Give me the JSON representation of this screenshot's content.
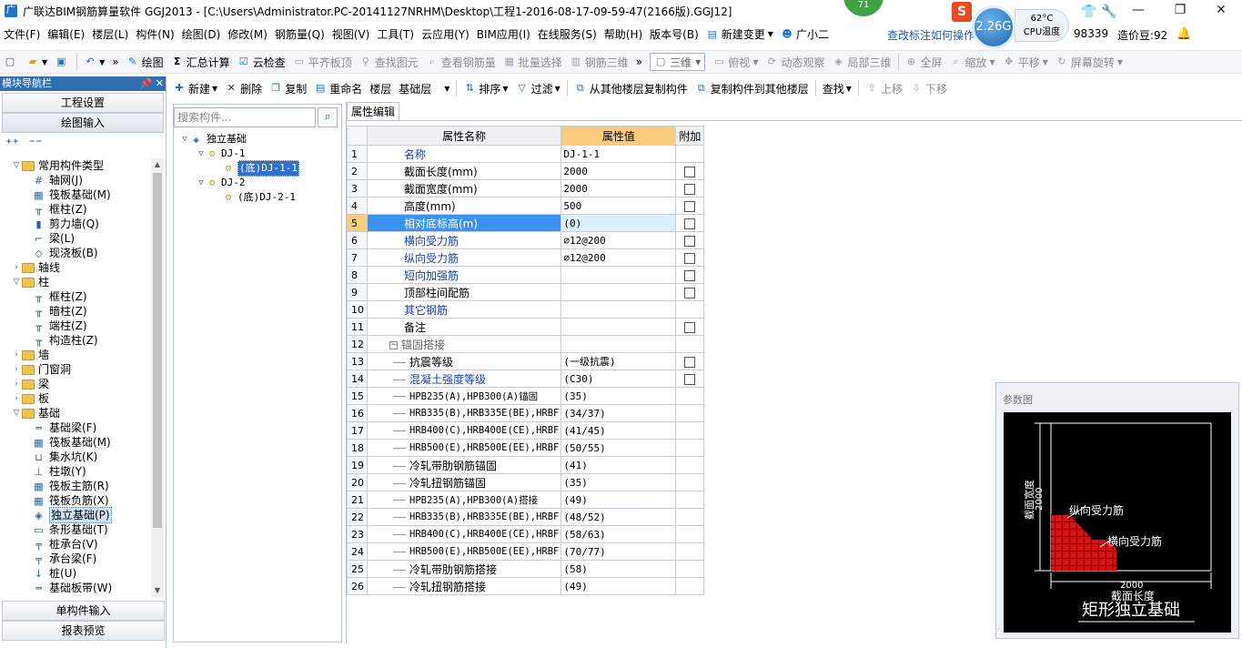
{
  "window": {
    "title": "广联达BIM钢筋算量软件 GGJ2013 - [C:\\Users\\Administrator.PC-20141127NRHM\\Desktop\\工程1-2016-08-17-09-59-47(2166版).GGJ12]",
    "app_icon": "广",
    "badge": "71",
    "speed": "2.26G",
    "cpu_temp": "62°C",
    "cpu_label": "CPU温度",
    "minimize": "—",
    "restore": "❐",
    "close": "✕"
  },
  "menu": {
    "items": [
      "文件(F)",
      "编辑(E)",
      "楼层(L)",
      "构件(N)",
      "绘图(D)",
      "修改(M)",
      "钢筋量(Q)",
      "视图(V)",
      "工具(T)",
      "云应用(Y)",
      "BIM应用(I)",
      "在线服务(S)",
      "帮助(H)",
      "版本号(B)"
    ],
    "new_change": "新建变更",
    "xiaoer": "广小二",
    "link": "查改标注如何操作",
    "account": "98339",
    "price_bean": "造价豆:92"
  },
  "toolbar": {
    "items": [
      "绘图",
      "汇总计算",
      "云检查",
      "平齐板顶",
      "查找图元",
      "查看钢筋量",
      "批量选择",
      "钢筋三维"
    ],
    "view_mode": "三维",
    "items2": [
      "俯视",
      "动态观察",
      "局部三维",
      "全屏",
      "缩放",
      "平移",
      "屏幕旋转"
    ]
  },
  "nav": {
    "header": "模块导航栏",
    "project_settings": "工程设置",
    "drawing_input": "绘图输入",
    "single_input": "单构件输入",
    "report_preview": "报表预览",
    "tree": [
      {
        "level": 0,
        "type": "folder",
        "exp": "▽",
        "label": "常用构件类型"
      },
      {
        "level": 1,
        "type": "item",
        "icon": "#",
        "label": "轴网(J)"
      },
      {
        "level": 1,
        "type": "item",
        "icon": "▦",
        "label": "筏板基础(M)"
      },
      {
        "level": 1,
        "type": "item",
        "icon": "╥",
        "label": "框柱(Z)"
      },
      {
        "level": 1,
        "type": "item",
        "icon": "▮",
        "label": "剪力墙(Q)"
      },
      {
        "level": 1,
        "type": "item",
        "icon": "⌐",
        "label": "梁(L)"
      },
      {
        "level": 1,
        "type": "item",
        "icon": "◇",
        "label": "现浇板(B)"
      },
      {
        "level": 0,
        "type": "folder",
        "exp": "›",
        "label": "轴线"
      },
      {
        "level": 0,
        "type": "folder",
        "exp": "▽",
        "label": "柱"
      },
      {
        "level": 1,
        "type": "item",
        "icon": "╥",
        "label": "框柱(Z)"
      },
      {
        "level": 1,
        "type": "item",
        "icon": "╥",
        "label": "暗柱(Z)"
      },
      {
        "level": 1,
        "type": "item",
        "icon": "╥",
        "label": "端柱(Z)"
      },
      {
        "level": 1,
        "type": "item",
        "icon": "╥",
        "label": "构造柱(Z)"
      },
      {
        "level": 0,
        "type": "folder",
        "exp": "›",
        "label": "墙"
      },
      {
        "level": 0,
        "type": "folder",
        "exp": "›",
        "label": "门窗洞"
      },
      {
        "level": 0,
        "type": "folder",
        "exp": "›",
        "label": "梁"
      },
      {
        "level": 0,
        "type": "folder",
        "exp": "›",
        "label": "板"
      },
      {
        "level": 0,
        "type": "folder",
        "exp": "▽",
        "label": "基础"
      },
      {
        "level": 1,
        "type": "item",
        "icon": "═",
        "label": "基础梁(F)"
      },
      {
        "level": 1,
        "type": "item",
        "icon": "▦",
        "label": "筏板基础(M)"
      },
      {
        "level": 1,
        "type": "item",
        "icon": "⊔",
        "label": "集水坑(K)"
      },
      {
        "level": 1,
        "type": "item",
        "icon": "⊥",
        "label": "柱墩(Y)"
      },
      {
        "level": 1,
        "type": "item",
        "icon": "▦",
        "label": "筏板主筋(R)"
      },
      {
        "level": 1,
        "type": "item",
        "icon": "▦",
        "label": "筏板负筋(X)"
      },
      {
        "level": 1,
        "type": "item",
        "icon": "◈",
        "label": "独立基础(P)",
        "selected": true
      },
      {
        "level": 1,
        "type": "item",
        "icon": "▭",
        "label": "条形基础(T)"
      },
      {
        "level": 1,
        "type": "item",
        "icon": "╤",
        "label": "桩承台(V)"
      },
      {
        "level": 1,
        "type": "item",
        "icon": "╤",
        "label": "承台梁(F)"
      },
      {
        "level": 1,
        "type": "item",
        "icon": "↓",
        "label": "桩(U)"
      },
      {
        "level": 1,
        "type": "item",
        "icon": "═",
        "label": "基础板带(W)"
      }
    ]
  },
  "comp_toolbar": [
    "新建",
    "删除",
    "复制",
    "重命名",
    "楼层",
    "基础层",
    "排序",
    "过滤",
    "从其他楼层复制构件",
    "复制构件到其他楼层",
    "查找",
    "上移",
    "下移"
  ],
  "comp_tree": {
    "search_placeholder": "搜索构件...",
    "nodes": [
      {
        "level": 0,
        "exp": "▽",
        "label": "独立基础",
        "kind": "root"
      },
      {
        "level": 1,
        "exp": "▽",
        "label": "DJ-1",
        "kind": "gear"
      },
      {
        "level": 2,
        "exp": "",
        "label": "(底)DJ-1-1",
        "kind": "gear",
        "selected": true
      },
      {
        "level": 1,
        "exp": "▽",
        "label": "DJ-2",
        "kind": "gear"
      },
      {
        "level": 2,
        "exp": "",
        "label": "(底)DJ-2-1",
        "kind": "gear"
      }
    ]
  },
  "props": {
    "tab": "属性编辑",
    "col_name": "属性名称",
    "col_value": "属性值",
    "col_add": "附加",
    "rows": [
      {
        "n": "1",
        "name": "名称",
        "value": "DJ-1-1",
        "cb": false,
        "style": "blue"
      },
      {
        "n": "2",
        "name": "截面长度(mm)",
        "value": "2000",
        "cb": true,
        "style": ""
      },
      {
        "n": "3",
        "name": "截面宽度(mm)",
        "value": "2000",
        "cb": true,
        "style": ""
      },
      {
        "n": "4",
        "name": "高度(mm)",
        "value": "500",
        "cb": true,
        "style": ""
      },
      {
        "n": "5",
        "name": "相对底标高(m)",
        "value": "(0)",
        "cb": true,
        "style": "sel"
      },
      {
        "n": "6",
        "name": "横向受力筋",
        "value": "⌀12@200",
        "cb": true,
        "style": "blue"
      },
      {
        "n": "7",
        "name": "纵向受力筋",
        "value": "⌀12@200",
        "cb": true,
        "style": "blue"
      },
      {
        "n": "8",
        "name": "短向加强筋",
        "value": "",
        "cb": true,
        "style": "blue"
      },
      {
        "n": "9",
        "name": "顶部柱间配筋",
        "value": "",
        "cb": true,
        "style": ""
      },
      {
        "n": "10",
        "name": "其它钢筋",
        "value": "",
        "cb": false,
        "style": "blue"
      },
      {
        "n": "11",
        "name": "备注",
        "value": "",
        "cb": true,
        "style": ""
      },
      {
        "n": "12",
        "name": "锚固搭接",
        "value": "",
        "cb": false,
        "style": "group"
      },
      {
        "n": "13",
        "name": "抗震等级",
        "value": "(一级抗震)",
        "cb": true,
        "style": "child"
      },
      {
        "n": "14",
        "name": "混凝土强度等级",
        "value": "(C30)",
        "cb": true,
        "style": "child blue"
      },
      {
        "n": "15",
        "name": "HPB235(A),HPB300(A)锚固",
        "value": "(35)",
        "cb": false,
        "style": "child mono"
      },
      {
        "n": "16",
        "name": "HRB335(B),HRB335E(BE),HRBF",
        "value": "(34/37)",
        "cb": false,
        "style": "child mono"
      },
      {
        "n": "17",
        "name": "HRB400(C),HRB400E(CE),HRBF",
        "value": "(41/45)",
        "cb": false,
        "style": "child mono"
      },
      {
        "n": "18",
        "name": "HRB500(E),HRB500E(EE),HRBF",
        "value": "(50/55)",
        "cb": false,
        "style": "child mono"
      },
      {
        "n": "19",
        "name": "冷轧带肋钢筋锚固",
        "value": "(41)",
        "cb": false,
        "style": "child"
      },
      {
        "n": "20",
        "name": "冷轧扭钢筋锚固",
        "value": "(35)",
        "cb": false,
        "style": "child"
      },
      {
        "n": "21",
        "name": "HPB235(A),HPB300(A)搭接",
        "value": "(49)",
        "cb": false,
        "style": "child mono"
      },
      {
        "n": "22",
        "name": "HRB335(B),HRB335E(BE),HRBF",
        "value": "(48/52)",
        "cb": false,
        "style": "child mono"
      },
      {
        "n": "23",
        "name": "HRB400(C),HRB400E(CE),HRBF",
        "value": "(58/63)",
        "cb": false,
        "style": "child mono"
      },
      {
        "n": "24",
        "name": "HRB500(E),HRB500E(EE),HRBF",
        "value": "(70/77)",
        "cb": false,
        "style": "child mono"
      },
      {
        "n": "25",
        "name": "冷轧带肋钢筋搭接",
        "value": "(58)",
        "cb": false,
        "style": "child"
      },
      {
        "n": "26",
        "name": "冷轧扭钢筋搭接",
        "value": "(49)",
        "cb": false,
        "style": "child"
      }
    ]
  },
  "param": {
    "title": "参数图",
    "width_label": "截面宽度",
    "width_value": "2000",
    "length_label": "截面长度",
    "length_value": "2000",
    "long_bar": "纵向受力筋",
    "trans_bar": "横向受力筋",
    "caption": "矩形独立基础"
  }
}
